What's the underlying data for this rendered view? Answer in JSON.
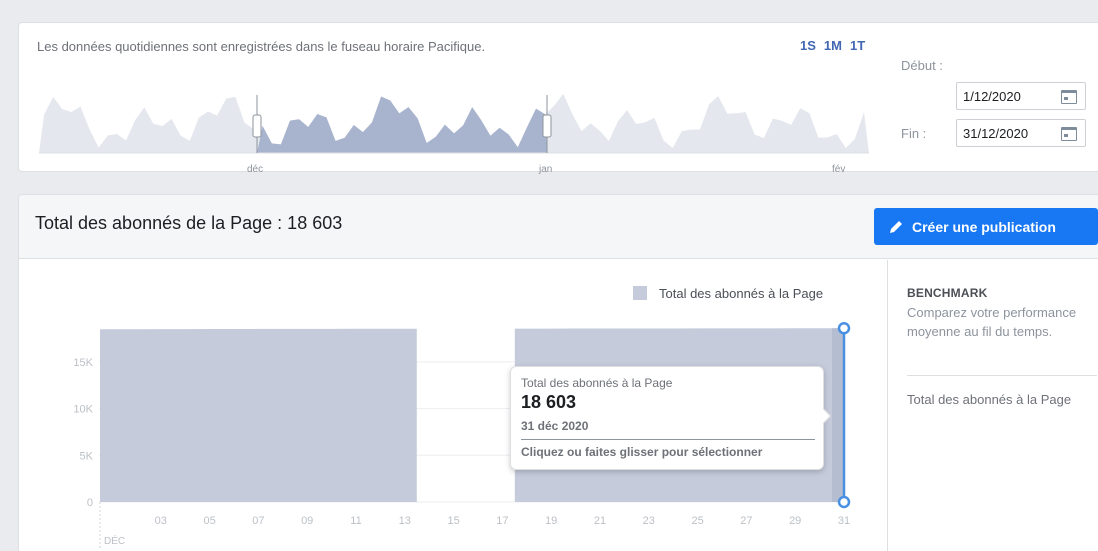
{
  "range": {
    "timezone_note": "Les données quotidiennes sont enregistrées dans le fuseau horaire Pacifique.",
    "presets": [
      "1S",
      "1M",
      "1T"
    ],
    "month_labels": [
      "déc",
      "jan",
      "fév"
    ],
    "start_label": "Début :",
    "start_value": "1/12/2020",
    "end_label": "Fin :",
    "end_value": "31/12/2020"
  },
  "header": {
    "title": "Total des abonnés de la Page : 18 603",
    "create_button": "Créer une publication"
  },
  "chart_data": {
    "type": "area",
    "legend": "Total des abonnés à la Page",
    "ylim": [
      0,
      18000
    ],
    "y_ticks": [
      {
        "label": "0",
        "v": 0
      },
      {
        "label": "5K",
        "v": 5000
      },
      {
        "label": "10K",
        "v": 10000
      },
      {
        "label": "15K",
        "v": 15000
      }
    ],
    "x_ticks": [
      "03",
      "05",
      "07",
      "09",
      "11",
      "13",
      "15",
      "17",
      "19",
      "21",
      "23",
      "25",
      "27",
      "29",
      "31"
    ],
    "x_month_label": "DÉC",
    "series": [
      {
        "name": "Total des abonnés à la Page",
        "x": [
          1,
          2,
          3,
          4,
          5,
          6,
          7,
          8,
          9,
          10,
          11,
          12,
          13,
          14,
          15,
          16,
          17,
          18,
          19,
          20,
          21,
          22,
          23,
          24,
          25,
          26,
          27,
          28,
          29,
          30,
          31
        ],
        "values": [
          18500,
          18500,
          18510,
          18510,
          18520,
          18520,
          18530,
          18530,
          18540,
          18540,
          18550,
          18550,
          18555,
          null,
          null,
          null,
          null,
          18560,
          18565,
          18570,
          18572,
          18575,
          18578,
          18580,
          18584,
          18588,
          18590,
          18594,
          18597,
          18600,
          18603
        ]
      }
    ],
    "tooltip": {
      "label": "Total des abonnés à la Page",
      "value": "18 603",
      "date": "31 déc 2020",
      "hint": "Cliquez ou faites glisser pour sélectionner"
    }
  },
  "benchmark": {
    "title": "BENCHMARK",
    "description": "Comparez votre performance moyenne au fil du temps.",
    "metric": "Total des abonnés à la Page"
  },
  "colors": {
    "accent": "#1877f2",
    "area": "#c5cbdb",
    "overview_selected": "#a8b3cd",
    "overview_unselected": "#e4e7ee",
    "highlight_line": "#4a90e2"
  }
}
